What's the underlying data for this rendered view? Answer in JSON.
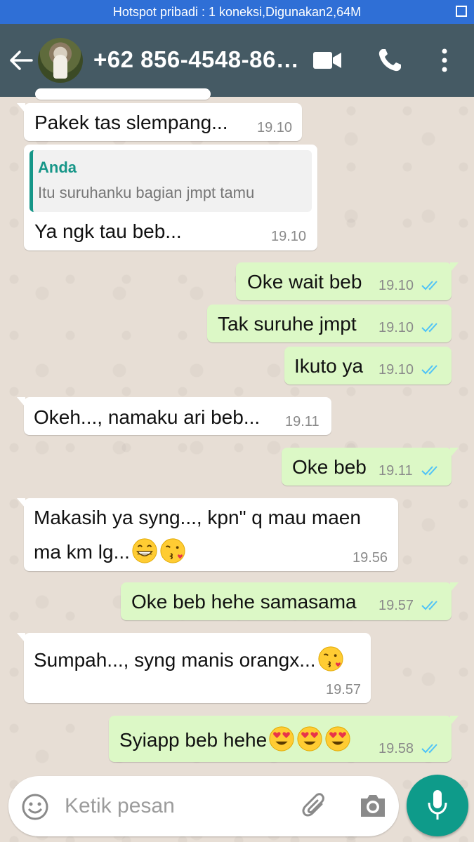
{
  "status_bar": {
    "text": "Hotspot pribadi : 1 koneksi,Digunakan2,64M"
  },
  "header": {
    "contact": "+62 856-4548-86…"
  },
  "colors": {
    "appbar": "#455a64",
    "status": "#2f6fd6",
    "outgoing": "#dcf8c6",
    "accent": "#0e9b8a",
    "tick": "#4fc3f7"
  },
  "messages": [
    {
      "dir": "in",
      "text": "Pakek tas slempang...",
      "time": "19.10"
    },
    {
      "dir": "in",
      "quote_name": "Anda",
      "quote_text": "Itu suruhanku bagian jmpt tamu",
      "text": "Ya ngk tau beb...",
      "time": "19.10"
    },
    {
      "dir": "out",
      "text": "Oke wait beb",
      "time": "19.10"
    },
    {
      "dir": "out",
      "text": "Tak suruhe jmpt",
      "time": "19.10"
    },
    {
      "dir": "out",
      "text": "Ikuto ya",
      "time": "19.10"
    },
    {
      "dir": "in",
      "text": "Okeh..., namaku ari beb...",
      "time": "19.11"
    },
    {
      "dir": "out",
      "text": "Oke beb",
      "time": "19.11"
    },
    {
      "dir": "in",
      "text_line1": "Makasih ya syng..., kpn\" q mau maen",
      "text_line2": "ma km lg...",
      "emojis": [
        "grin",
        "kiss"
      ],
      "time": "19.56"
    },
    {
      "dir": "out",
      "text": "Oke beb hehe samasama",
      "time": "19.57"
    },
    {
      "dir": "in",
      "text": "Sumpah..., syng manis orangx...",
      "emojis": [
        "kiss"
      ],
      "time": "19.57"
    },
    {
      "dir": "out",
      "text": "Syiapp beb hehe",
      "emojis": [
        "heart-eyes",
        "heart-eyes",
        "heart-eyes"
      ],
      "time": "19.58"
    }
  ],
  "composer": {
    "placeholder": "Ketik pesan"
  },
  "icons": [
    "back-arrow-icon",
    "video-call-icon",
    "phone-icon",
    "more-options-icon",
    "emoji-icon",
    "attach-icon",
    "camera-icon",
    "mic-icon",
    "double-check-icon"
  ]
}
